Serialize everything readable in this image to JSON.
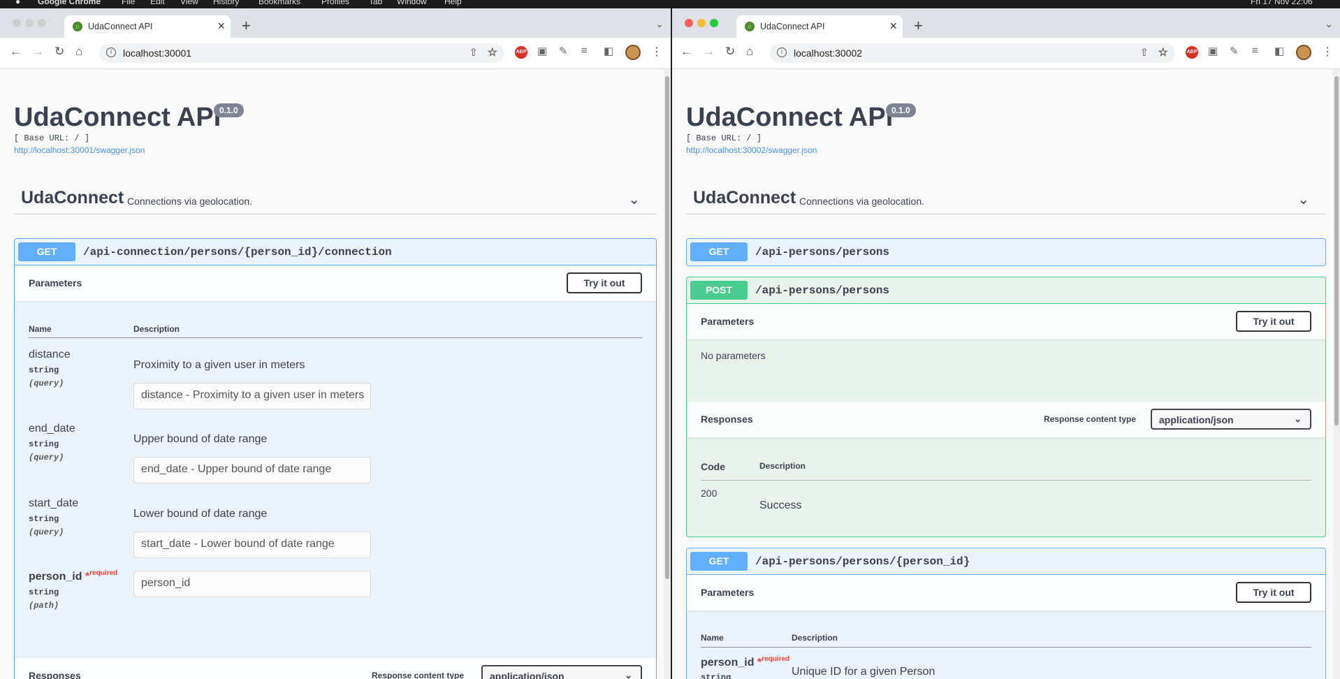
{
  "menubar": {
    "app_name": "Google Chrome",
    "items": [
      "File",
      "Edit",
      "View",
      "History",
      "Bookmarks",
      "Profiles",
      "Tab",
      "Window",
      "Help"
    ],
    "clock": "Fri 17 Nov 22:06"
  },
  "left": {
    "tab_title": "UdaConnect API",
    "url": "localhost:30001",
    "api_title": "UdaConnect API",
    "version": "0.1.0",
    "base_url": "[ Base URL: / ]",
    "swagger_link": "http://localhost:30001/swagger.json",
    "tag_name": "UdaConnect",
    "tag_desc": "Connections via geolocation.",
    "op": {
      "method": "GET",
      "path": "/api-connection/persons/{person_id}/connection",
      "params_title": "Parameters",
      "try_label": "Try it out",
      "col_name": "Name",
      "col_desc": "Description",
      "params": [
        {
          "name": "distance",
          "type": "string",
          "in": "(query)",
          "desc": "Proximity to a given user in meters",
          "placeholder": "distance - Proximity to a given user in meters"
        },
        {
          "name": "end_date",
          "type": "string",
          "in": "(query)",
          "desc": "Upper bound of date range",
          "placeholder": "end_date - Upper bound of date range"
        },
        {
          "name": "start_date",
          "type": "string",
          "in": "(query)",
          "desc": "Lower bound of date range",
          "placeholder": "start_date - Lower bound of date range"
        },
        {
          "name": "person_id",
          "required_mark": "*",
          "required_label": "required",
          "type": "string",
          "in": "(path)",
          "placeholder": "person_id"
        }
      ],
      "responses_title": "Responses",
      "response_content_type_label": "Response content type",
      "response_content_type": "application/json"
    }
  },
  "right": {
    "tab_title": "UdaConnect API",
    "url": "localhost:30002",
    "api_title": "UdaConnect API",
    "version": "0.1.0",
    "base_url": "[ Base URL: / ]",
    "swagger_link": "http://localhost:30002/swagger.json",
    "tag_name": "UdaConnect",
    "tag_desc": "Connections via geolocation.",
    "op1": {
      "method": "GET",
      "path": "/api-persons/persons"
    },
    "op2": {
      "method": "POST",
      "path": "/api-persons/persons",
      "params_title": "Parameters",
      "try_label": "Try it out",
      "no_params": "No parameters",
      "responses_title": "Responses",
      "response_content_type_label": "Response content type",
      "response_content_type": "application/json",
      "col_code": "Code",
      "col_desc": "Description",
      "code": "200",
      "code_desc": "Success"
    },
    "op3": {
      "method": "GET",
      "path": "/api-persons/persons/{person_id}",
      "params_title": "Parameters",
      "try_label": "Try it out",
      "col_name": "Name",
      "col_desc": "Description",
      "param_name": "person_id",
      "required_mark": "*",
      "required_label": "required",
      "param_type": "string",
      "param_desc": "Unique ID for a given Person"
    }
  }
}
